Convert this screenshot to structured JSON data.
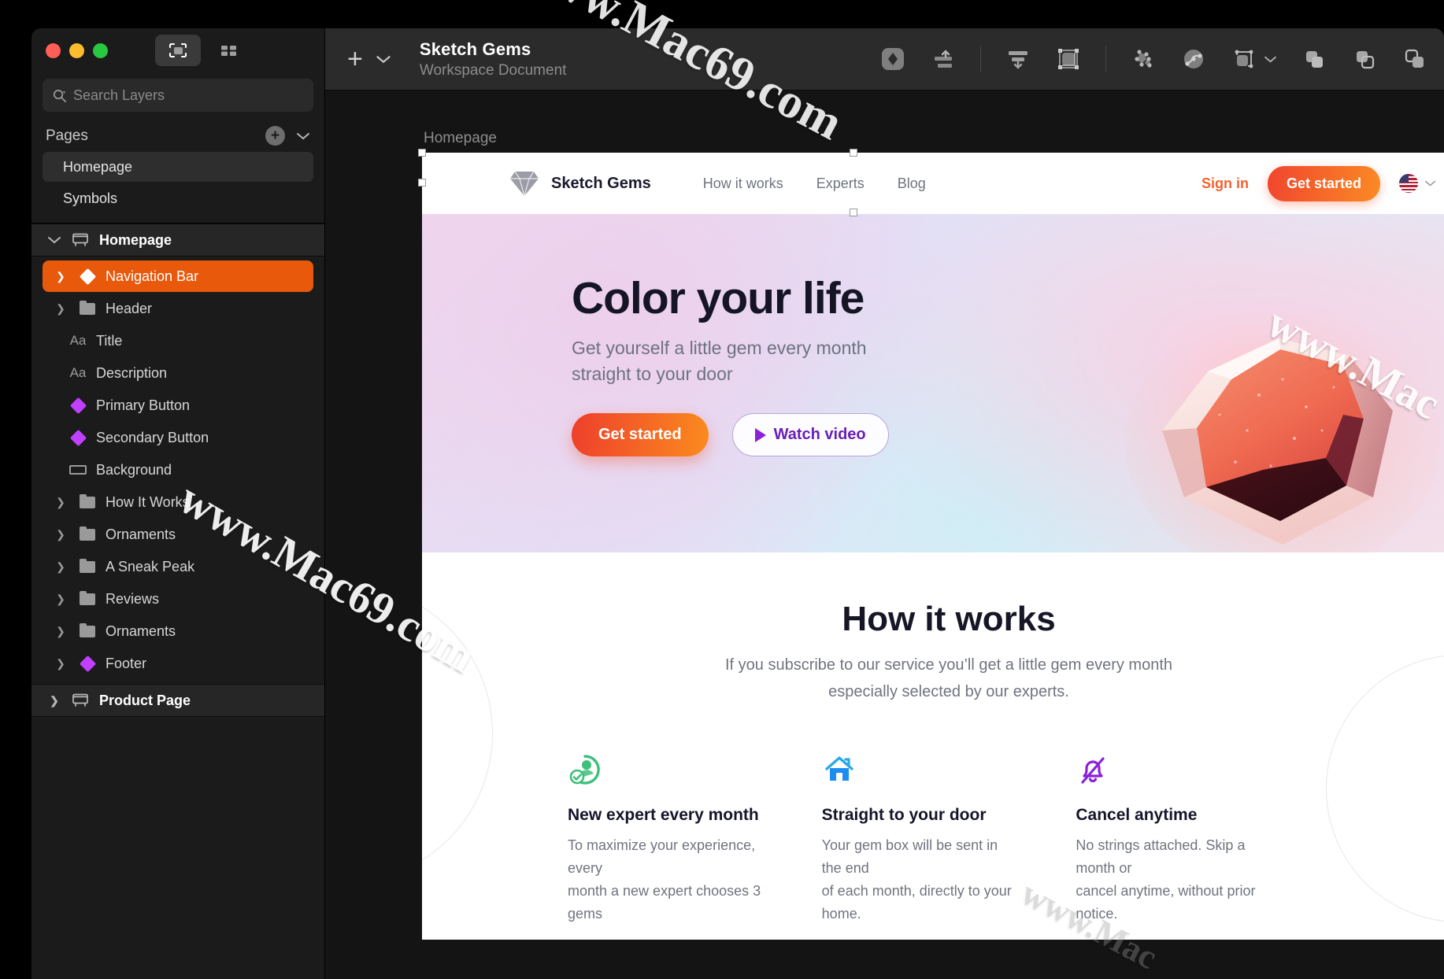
{
  "window": {
    "traffic_lights": [
      "close",
      "minimize",
      "zoom"
    ],
    "view_toggle_canvas": "canvas-view",
    "view_toggle_grid": "grid-view"
  },
  "sidebar": {
    "search": {
      "placeholder": "Search Layers",
      "value": ""
    },
    "pages_section": {
      "label": "Pages",
      "add_label": "+",
      "items": [
        {
          "label": "Homepage",
          "selected": true
        },
        {
          "label": "Symbols",
          "selected": false
        }
      ]
    },
    "layers": [
      {
        "label": "Homepage",
        "icon": "artboard-icon",
        "indent": 0,
        "kind": "artboard",
        "expanded": true,
        "selected": false
      },
      {
        "label": "Navigation Bar",
        "icon": "symbol-icon",
        "indent": 1,
        "kind": "symbol",
        "expanded": false,
        "selected": true
      },
      {
        "label": "Header",
        "icon": "folder-icon",
        "indent": 1,
        "kind": "group",
        "expanded": true,
        "selected": false
      },
      {
        "label": "Title",
        "icon": "text-icon",
        "indent": 2,
        "kind": "text",
        "selected": false
      },
      {
        "label": "Description",
        "icon": "text-icon",
        "indent": 2,
        "kind": "text",
        "selected": false
      },
      {
        "label": "Primary Button",
        "icon": "symbol-icon",
        "indent": 2,
        "kind": "symbol",
        "selected": false
      },
      {
        "label": "Secondary Button",
        "icon": "symbol-icon",
        "indent": 2,
        "kind": "symbol",
        "selected": false
      },
      {
        "label": "Background",
        "icon": "rectangle-icon",
        "indent": 2,
        "kind": "shape",
        "selected": false
      },
      {
        "label": "How It Works",
        "icon": "folder-icon",
        "indent": 1,
        "kind": "group",
        "expanded": false,
        "selected": false
      },
      {
        "label": "Ornaments",
        "icon": "folder-icon",
        "indent": 1,
        "kind": "group",
        "expanded": false,
        "selected": false
      },
      {
        "label": "A Sneak Peak",
        "icon": "folder-icon",
        "indent": 1,
        "kind": "group",
        "expanded": false,
        "selected": false
      },
      {
        "label": "Reviews",
        "icon": "folder-icon",
        "indent": 1,
        "kind": "group",
        "expanded": false,
        "selected": false
      },
      {
        "label": "Ornaments",
        "icon": "folder-icon",
        "indent": 1,
        "kind": "group",
        "expanded": false,
        "selected": false
      },
      {
        "label": "Footer",
        "icon": "symbol-icon",
        "indent": 1,
        "kind": "symbol",
        "expanded": false,
        "selected": false
      },
      {
        "label": "Product Page",
        "icon": "artboard-icon",
        "indent": 0,
        "kind": "artboard",
        "expanded": false,
        "selected": false
      }
    ]
  },
  "toolbar": {
    "add_label": "+",
    "document_title": "Sketch Gems",
    "document_subtitle": "Workspace Document",
    "icons": [
      "symbol-icon",
      "align-vertical-icon",
      "distribute-vertical-icon",
      "scale-icon",
      "flatten-icon",
      "vector-icon",
      "shape-icon",
      "union-icon",
      "subtract-icon",
      "intersect-icon"
    ]
  },
  "canvas": {
    "artboard_name": "Homepage",
    "site": {
      "nav": {
        "brand": "Sketch Gems",
        "links": [
          "How it works",
          "Experts",
          "Blog"
        ],
        "signin": "Sign in",
        "cta": "Get started",
        "locale": "US"
      },
      "hero": {
        "title": "Color your life",
        "subtitle_line1": "Get yourself a little gem every month",
        "subtitle_line2": "straight to your door",
        "primary_cta": "Get started",
        "secondary_cta": "Watch video"
      },
      "how_it_works": {
        "heading": "How it works",
        "sub_line1": "If you subscribe to our service you’ll get a little gem every month",
        "sub_line2": "especially selected by our experts.",
        "features": [
          {
            "icon": "expert-badge-icon",
            "color": "#3cc07a",
            "title": "New expert every month",
            "body_line1": "To maximize your experience, every",
            "body_line2": "month a new expert chooses 3 gems"
          },
          {
            "icon": "home-icon",
            "color": "#1b8ef0",
            "title": "Straight to your door",
            "body_line1": "Your gem box will be sent in the end",
            "body_line2": "of each month, directly to your home."
          },
          {
            "icon": "bell-off-icon",
            "color": "#8b22d8",
            "title": "Cancel anytime",
            "body_line1": "No strings attached. Skip a month or",
            "body_line2": "cancel anytime, without prior notice."
          }
        ]
      }
    }
  },
  "watermarks": {
    "text": "www.Mac69.com",
    "short": "www.Mac"
  },
  "colors": {
    "accent_orange": "#e8590c",
    "cta_orange_start": "#ee3f2c",
    "cta_orange_end": "#fb8b1e",
    "purple": "#8b22d8",
    "symbol_magenta": "#c13fff",
    "sidebar_bg": "#1b1b1b",
    "toolbar_bg": "#2b2b2b",
    "canvas_bg": "#141414"
  }
}
